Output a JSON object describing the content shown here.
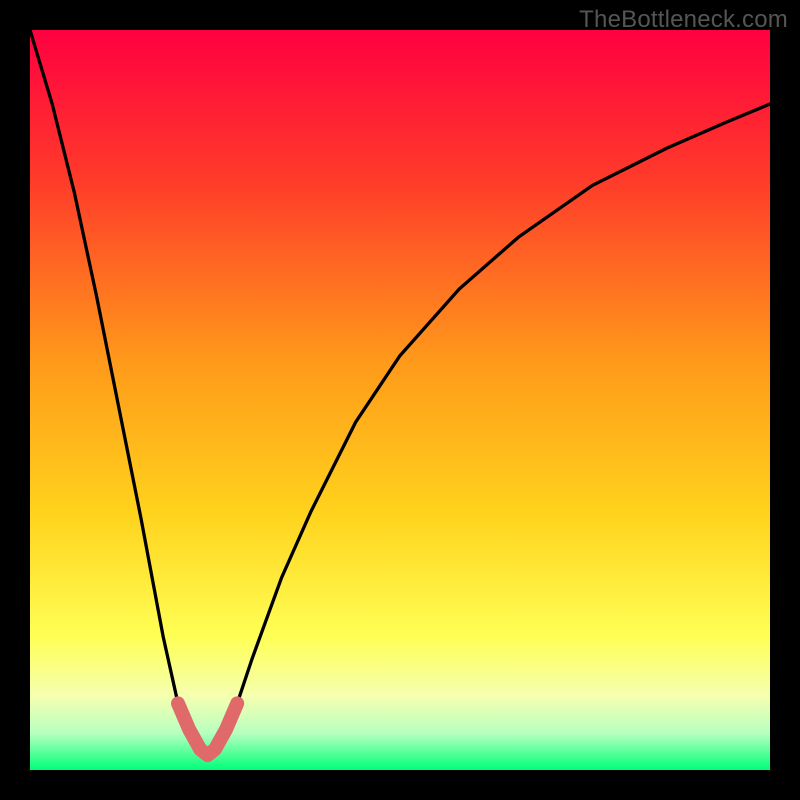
{
  "watermark": "TheBottleneck.com",
  "colors": {
    "background": "#000000",
    "curve": "#000000",
    "dip_marker": "#e06a6a",
    "gradient_stops": [
      {
        "offset": "0%",
        "color": "#ff0040"
      },
      {
        "offset": "20%",
        "color": "#ff3a2a"
      },
      {
        "offset": "45%",
        "color": "#ff9a1a"
      },
      {
        "offset": "65%",
        "color": "#ffd21c"
      },
      {
        "offset": "82%",
        "color": "#ffff55"
      },
      {
        "offset": "90%",
        "color": "#f5ffb0"
      },
      {
        "offset": "95%",
        "color": "#b8ffc0"
      },
      {
        "offset": "100%",
        "color": "#00ff7a"
      }
    ]
  },
  "chart_data": {
    "type": "line",
    "title": "",
    "xlabel": "",
    "ylabel": "",
    "xlim": [
      0,
      100
    ],
    "ylim": [
      0,
      100
    ],
    "curve": {
      "description": "V-shaped bottleneck curve with minimum near x≈24; left branch rises steeply to top-left, right branch rises with decreasing slope toward upper-right",
      "x": [
        0,
        3,
        6,
        9,
        12,
        15,
        18,
        20,
        22,
        23,
        24,
        25,
        26,
        28,
        30,
        34,
        38,
        44,
        50,
        58,
        66,
        76,
        86,
        94,
        100
      ],
      "y": [
        100,
        90,
        78,
        64,
        49,
        34,
        18,
        9,
        3.8,
        2.3,
        2,
        2.3,
        3.8,
        9,
        15,
        26,
        35,
        47,
        56,
        65,
        72,
        79,
        84,
        87.5,
        90
      ]
    },
    "optimal_marker": {
      "description": "Thick salmon-colored U-shaped marker at curve minimum (low-bottleneck zone)",
      "x": [
        20,
        21.5,
        23,
        24,
        25,
        26.5,
        28
      ],
      "y": [
        9,
        5.5,
        2.8,
        2,
        2.8,
        5.5,
        9
      ]
    }
  }
}
